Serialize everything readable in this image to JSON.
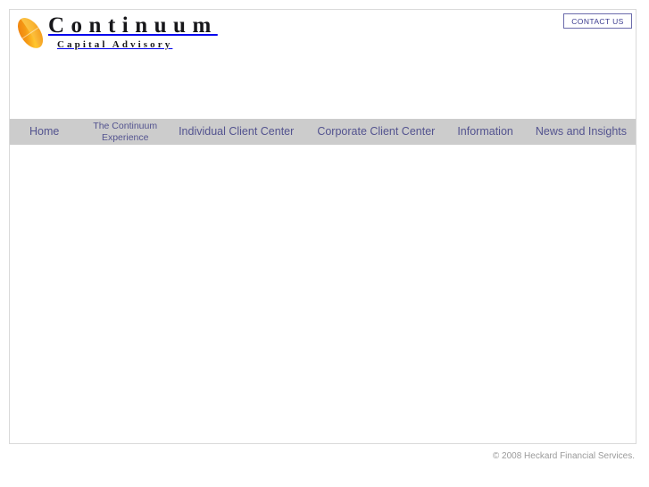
{
  "header": {
    "logo": {
      "mark_icon": "gradient-ellipse-icon",
      "title": "Continuum",
      "subtitle": "Capital Advisory",
      "mark_color_start": "#f07a12",
      "mark_color_end": "#ffd24a"
    },
    "contact_button": {
      "label": "CONTACT US",
      "border_color": "#6b6bab",
      "text_color": "#3b3b8f"
    }
  },
  "nav": {
    "background_color": "#cccccc",
    "text_color": "#53538f",
    "items": [
      {
        "label": "Home",
        "lines": [
          "Home"
        ]
      },
      {
        "label": "The Continuum Experience",
        "lines": [
          "The Continuum",
          "Experience"
        ]
      },
      {
        "label": "Individual Client Center",
        "lines": [
          "Individual Client Center"
        ]
      },
      {
        "label": "Corporate Client Center",
        "lines": [
          "Corporate Client Center"
        ]
      },
      {
        "label": "Information",
        "lines": [
          "Information"
        ]
      },
      {
        "label": "News and Insights",
        "lines": [
          "News and Insights"
        ]
      }
    ]
  },
  "main": {
    "content": ""
  },
  "footer": {
    "copyright": "© 2008 Heckard Financial Services.",
    "text_color": "#9a9a9a"
  }
}
